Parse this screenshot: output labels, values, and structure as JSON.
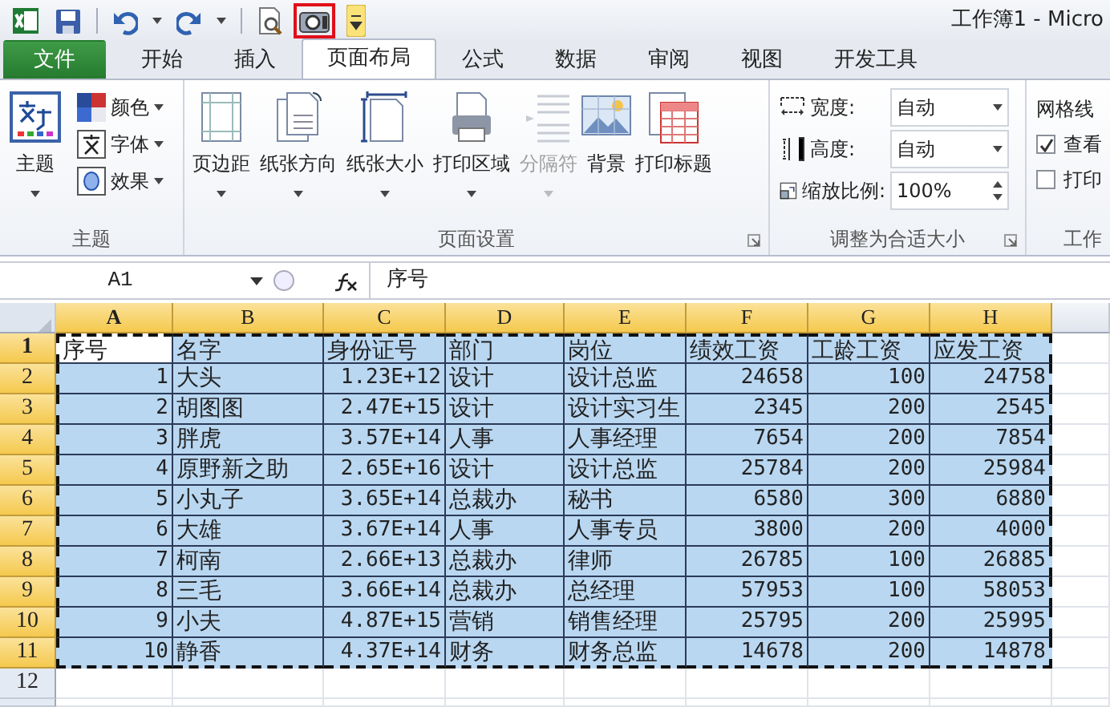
{
  "window": {
    "title": "工作簿1 - Micro"
  },
  "quick_access": [
    {
      "kind": "app",
      "highlighted": false
    },
    {
      "kind": "save",
      "highlighted": false
    },
    {
      "kind": "undo",
      "highlighted": false
    },
    {
      "kind": "redo",
      "highlighted": false
    },
    {
      "kind": "preview",
      "highlighted": false
    },
    {
      "kind": "camera",
      "highlighted": true
    },
    {
      "kind": "customize",
      "highlighted": false
    }
  ],
  "tabs": [
    {
      "label": "文件",
      "kind": "file",
      "selected": false
    },
    {
      "label": "开始",
      "kind": "tab",
      "selected": false
    },
    {
      "label": "插入",
      "kind": "tab",
      "selected": false
    },
    {
      "label": "页面布局",
      "kind": "tab",
      "selected": true
    },
    {
      "label": "公式",
      "kind": "tab",
      "selected": false
    },
    {
      "label": "数据",
      "kind": "tab",
      "selected": false
    },
    {
      "label": "审阅",
      "kind": "tab",
      "selected": false
    },
    {
      "label": "视图",
      "kind": "tab",
      "selected": false
    },
    {
      "label": "开发工具",
      "kind": "tab",
      "selected": false
    }
  ],
  "ribbon": [
    {
      "label": "主题",
      "kind": "buttons",
      "launcher": false,
      "items": [
        {
          "label": "主题",
          "kind": "large",
          "dropdown": true,
          "disabled": false
        },
        {
          "label": "颜色",
          "kind": "small",
          "dropdown": true,
          "disabled": false
        },
        {
          "label": "字体",
          "kind": "small",
          "dropdown": true,
          "disabled": false
        },
        {
          "label": "效果",
          "kind": "small",
          "dropdown": true,
          "disabled": false
        }
      ]
    },
    {
      "label": "页面设置",
      "kind": "buttons",
      "launcher": true,
      "items": [
        {
          "label": "页边距",
          "kind": "large",
          "dropdown": true,
          "disabled": false
        },
        {
          "label": "纸张方向",
          "kind": "large",
          "dropdown": true,
          "disabled": false
        },
        {
          "label": "纸张大小",
          "kind": "large",
          "dropdown": true,
          "disabled": false
        },
        {
          "label": "打印区域",
          "kind": "large",
          "dropdown": true,
          "disabled": false
        },
        {
          "label": "分隔符",
          "kind": "large",
          "dropdown": true,
          "disabled": true
        },
        {
          "label": "背景",
          "kind": "large",
          "dropdown": false,
          "disabled": false
        },
        {
          "label": "打印标题",
          "kind": "large",
          "dropdown": false,
          "disabled": false
        }
      ]
    },
    {
      "label": "调整为合适大小",
      "kind": "fields",
      "launcher": true,
      "items": [
        {
          "label": "宽度:",
          "value": "自动",
          "kind": "dropdown"
        },
        {
          "label": "高度:",
          "value": "自动",
          "kind": "dropdown"
        },
        {
          "label": "缩放比例:",
          "value": "100%",
          "kind": "spinner"
        }
      ]
    },
    {
      "label": "工作",
      "kind": "checks",
      "launcher": false,
      "heading": "网格线",
      "items": [
        {
          "label": "查看",
          "checked": true
        },
        {
          "label": "打印",
          "checked": false
        }
      ]
    }
  ],
  "formula_bar": {
    "name_box": "A1",
    "formula": "序号"
  },
  "sheet": {
    "columns": [
      {
        "label": "A",
        "selected": true,
        "active": true,
        "numeric": true
      },
      {
        "label": "B",
        "selected": true,
        "active": false,
        "numeric": false
      },
      {
        "label": "C",
        "selected": true,
        "active": false,
        "numeric": true
      },
      {
        "label": "D",
        "selected": true,
        "active": false,
        "numeric": false
      },
      {
        "label": "E",
        "selected": true,
        "active": false,
        "numeric": false
      },
      {
        "label": "F",
        "selected": true,
        "active": false,
        "numeric": true
      },
      {
        "label": "G",
        "selected": true,
        "active": false,
        "numeric": true
      },
      {
        "label": "H",
        "selected": true,
        "active": false,
        "numeric": true
      }
    ],
    "rows": [
      {
        "label": "1",
        "selected": true,
        "active": true,
        "kind": "header",
        "cells": [
          "序号",
          "名字",
          "身份证号",
          "部门",
          "岗位",
          "绩效工资",
          "工龄工资",
          "应发工资"
        ]
      },
      {
        "label": "2",
        "selected": true,
        "active": false,
        "kind": "data",
        "cells": [
          "1",
          "大头",
          "1.23E+12",
          "设计",
          "设计总监",
          "24658",
          "100",
          "24758"
        ]
      },
      {
        "label": "3",
        "selected": true,
        "active": false,
        "kind": "data",
        "cells": [
          "2",
          "胡图图",
          "2.47E+15",
          "设计",
          "设计实习生",
          "2345",
          "200",
          "2545"
        ]
      },
      {
        "label": "4",
        "selected": true,
        "active": false,
        "kind": "data",
        "cells": [
          "3",
          "胖虎",
          "3.57E+14",
          "人事",
          "人事经理",
          "7654",
          "200",
          "7854"
        ]
      },
      {
        "label": "5",
        "selected": true,
        "active": false,
        "kind": "data",
        "cells": [
          "4",
          "原野新之助",
          "2.65E+16",
          "设计",
          "设计总监",
          "25784",
          "200",
          "25984"
        ]
      },
      {
        "label": "6",
        "selected": true,
        "active": false,
        "kind": "data",
        "cells": [
          "5",
          "小丸子",
          "3.65E+14",
          "总裁办",
          "秘书",
          "6580",
          "300",
          "6880"
        ]
      },
      {
        "label": "7",
        "selected": true,
        "active": false,
        "kind": "data",
        "cells": [
          "6",
          "大雄",
          "3.67E+14",
          "人事",
          "人事专员",
          "3800",
          "200",
          "4000"
        ]
      },
      {
        "label": "8",
        "selected": true,
        "active": false,
        "kind": "data",
        "cells": [
          "7",
          "柯南",
          "2.66E+13",
          "总裁办",
          "律师",
          "26785",
          "100",
          "26885"
        ]
      },
      {
        "label": "9",
        "selected": true,
        "active": false,
        "kind": "data",
        "cells": [
          "8",
          "三毛",
          "3.66E+14",
          "总裁办",
          "总经理",
          "57953",
          "100",
          "58053"
        ]
      },
      {
        "label": "10",
        "selected": true,
        "active": false,
        "kind": "data",
        "cells": [
          "9",
          "小夫",
          "4.87E+15",
          "营销",
          "销售经理",
          "25795",
          "200",
          "25995"
        ]
      },
      {
        "label": "11",
        "selected": true,
        "active": false,
        "kind": "data",
        "cells": [
          "10",
          "静香",
          "4.37E+14",
          "财务",
          "财务总监",
          "14678",
          "200",
          "14878"
        ]
      },
      {
        "label": "12",
        "selected": false,
        "active": false,
        "kind": "empty"
      }
    ]
  }
}
